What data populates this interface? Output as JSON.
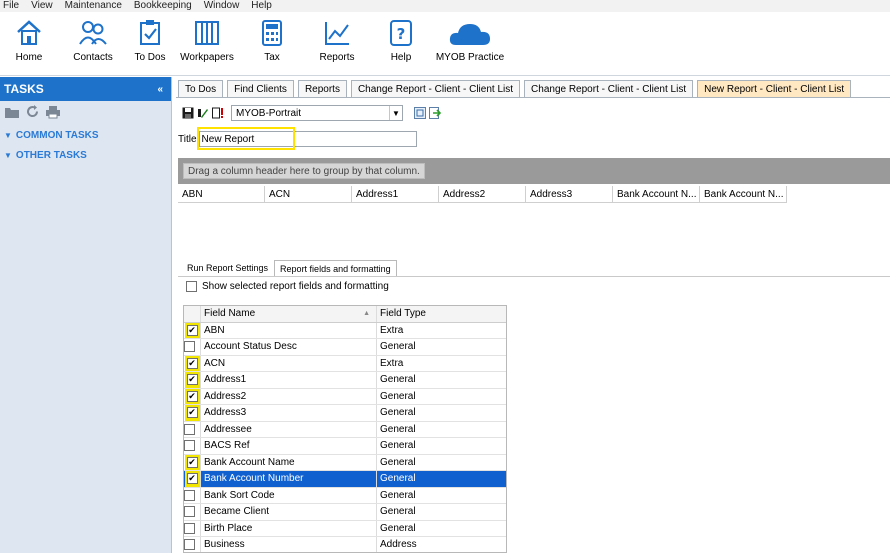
{
  "menu": [
    "File",
    "View",
    "Maintenance",
    "Bookkeeping",
    "Window",
    "Help"
  ],
  "ribbon": [
    {
      "label": "Home",
      "icon": "home-icon"
    },
    {
      "label": "Contacts",
      "icon": "contacts-icon"
    },
    {
      "label": "To Dos",
      "icon": "todos-icon"
    },
    {
      "label": "Workpapers",
      "icon": "workpapers-icon"
    },
    {
      "label": "Tax",
      "icon": "tax-icon"
    },
    {
      "label": "Reports",
      "icon": "reports-icon"
    },
    {
      "label": "Help",
      "icon": "help-icon"
    },
    {
      "label": "MYOB Practice",
      "icon": "cloud-icon"
    }
  ],
  "tasks": {
    "title": "TASKS",
    "links": [
      "COMMON TASKS",
      "OTHER TASKS"
    ]
  },
  "tabs": [
    {
      "label": "To Dos",
      "active": false
    },
    {
      "label": "Find Clients",
      "active": false
    },
    {
      "label": "Reports",
      "active": false
    },
    {
      "label": "Change Report - Client - Client List",
      "active": false
    },
    {
      "label": "Change Report - Client - Client List",
      "active": false
    },
    {
      "label": "New Report - Client - Client List",
      "active": true
    }
  ],
  "toolbar": {
    "template": "MYOB-Portrait"
  },
  "title_field": {
    "label": "Title",
    "value": "New Report"
  },
  "group_hint": "Drag a column header here to group by that column.",
  "columns": [
    "ABN",
    "ACN",
    "Address1",
    "Address2",
    "Address3",
    "Bank Account N...",
    "Bank Account N..."
  ],
  "subtabs": [
    {
      "label": "Run Report Settings",
      "active": false
    },
    {
      "label": "Report fields and formatting",
      "active": true
    }
  ],
  "show_selected_label": "Show selected report fields and formatting",
  "grid": {
    "headers": {
      "name": "Field Name",
      "type": "Field Type"
    },
    "rows": [
      {
        "name": "ABN",
        "type": "Extra",
        "checked": true,
        "highlight": true
      },
      {
        "name": "Account Status Desc",
        "type": "General",
        "checked": false,
        "highlight": false
      },
      {
        "name": "ACN",
        "type": "Extra",
        "checked": true,
        "highlight": true
      },
      {
        "name": "Address1",
        "type": "General",
        "checked": true,
        "highlight": true
      },
      {
        "name": "Address2",
        "type": "General",
        "checked": true,
        "highlight": true
      },
      {
        "name": "Address3",
        "type": "General",
        "checked": true,
        "highlight": true
      },
      {
        "name": "Addressee",
        "type": "General",
        "checked": false,
        "highlight": false
      },
      {
        "name": "BACS Ref",
        "type": "General",
        "checked": false,
        "highlight": false
      },
      {
        "name": "Bank Account Name",
        "type": "General",
        "checked": true,
        "highlight": true
      },
      {
        "name": "Bank Account Number",
        "type": "General",
        "checked": true,
        "highlight": true,
        "selected": true
      },
      {
        "name": "Bank Sort Code",
        "type": "General",
        "checked": false,
        "highlight": false
      },
      {
        "name": "Became Client",
        "type": "General",
        "checked": false,
        "highlight": false
      },
      {
        "name": "Birth Place",
        "type": "General",
        "checked": false,
        "highlight": false
      },
      {
        "name": "Business",
        "type": "Address",
        "checked": false,
        "highlight": false
      }
    ]
  },
  "colors": {
    "accent": "#1e72c9",
    "highlight": "#ffe200",
    "selection": "#1060d0",
    "active_tab": "#ffe8c2"
  }
}
